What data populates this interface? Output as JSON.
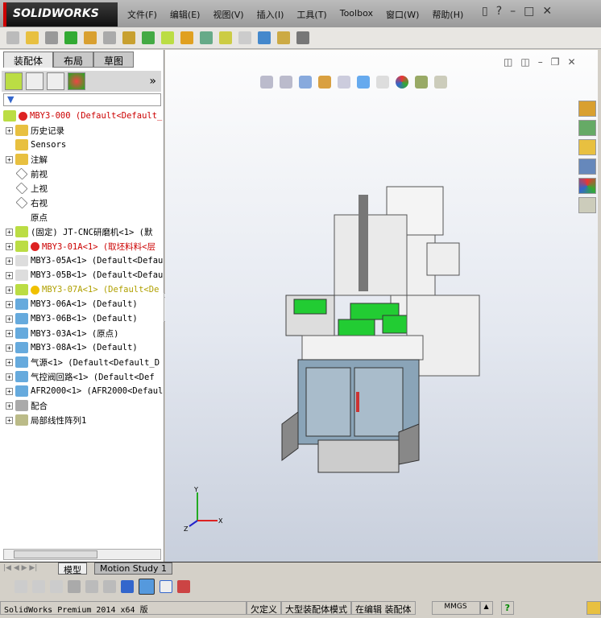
{
  "app": {
    "logo": "SOLIDWORKS"
  },
  "menu": [
    "文件(F)",
    "编辑(E)",
    "视图(V)",
    "插入(I)",
    "工具(T)",
    "Toolbox",
    "窗口(W)",
    "帮助(H)"
  ],
  "panel": {
    "tabs": [
      "装配体",
      "布局",
      "草图"
    ],
    "more": "»",
    "filter": "▼"
  },
  "tree": [
    {
      "label": "MBY3-000  (Default<Default_",
      "style": "red",
      "exp": false
    },
    {
      "label": "历史记录",
      "exp": true
    },
    {
      "label": "Sensors",
      "exp": false
    },
    {
      "label": "注解",
      "exp": true
    },
    {
      "label": "前视",
      "exp": false
    },
    {
      "label": "上视",
      "exp": false
    },
    {
      "label": "右视",
      "exp": false
    },
    {
      "label": "原点",
      "exp": false
    },
    {
      "label": "(固定) JT-CNC研磨机<1> (默",
      "exp": true
    },
    {
      "label": "MBY3-01A<1> (取坯料料<层",
      "style": "red",
      "exp": true
    },
    {
      "label": "MBY3-05A<1> (Default<Defaul",
      "exp": true
    },
    {
      "label": "MBY3-05B<1> (Default<Defaul",
      "exp": true
    },
    {
      "label": "MBY3-07A<1> (Default<De",
      "style": "yel",
      "exp": true
    },
    {
      "label": "MBY3-06A<1> (Default)",
      "exp": true
    },
    {
      "label": "MBY3-06B<1> (Default)",
      "exp": true
    },
    {
      "label": "MBY3-03A<1> (原点)",
      "exp": true
    },
    {
      "label": "MBY3-08A<1> (Default)",
      "exp": true
    },
    {
      "label": "气源<1> (Default<Default_D",
      "exp": true
    },
    {
      "label": "气控阀回路<1> (Default<Def",
      "exp": true
    },
    {
      "label": "AFR2000<1> (AFR2000<Defaul",
      "exp": true
    },
    {
      "label": "配合",
      "exp": true
    },
    {
      "label": "局部线性阵列1",
      "exp": true
    }
  ],
  "bottom_tabs": [
    "模型",
    "Motion Study 1"
  ],
  "status": {
    "product": "SolidWorks Premium 2014 x64 版",
    "defined": "欠定义",
    "mode": "大型装配体模式",
    "editing": "在编辑 装配体",
    "units": "MMGS",
    "units_arrow": "▲",
    "help": "?"
  },
  "axes": {
    "x": "X",
    "y": "Y",
    "z": "Z"
  }
}
